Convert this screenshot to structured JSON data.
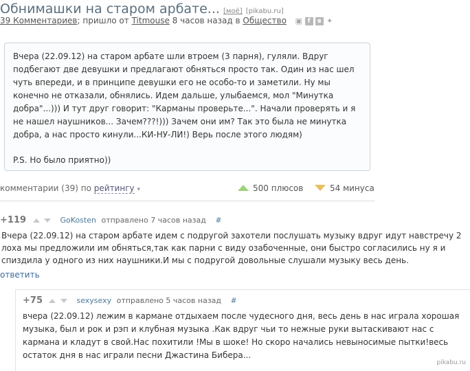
{
  "header": {
    "title": "Обнимашки на старом арбате...",
    "tag_mine": "[моё]",
    "source": "[pikabu.ru]"
  },
  "meta": {
    "comments_link": "39 Комментариев",
    "came_from": "; пришло от",
    "author": "Titmouse",
    "time": "8 часов назад в",
    "category": "Общество"
  },
  "share_icons": [
    "save-icon",
    "facebook-icon",
    "vkontakte-icon",
    "twitter-icon"
  ],
  "story": {
    "text": "Вчера (22.09.12) на старом арбате шли втроем (3 парня), гуляли. Вдруг подбегают две девушки и предлагают обняться просто так. Один из нас шел чуть впереди, и в принципе девушки его не особо-то и заметили. Ну мы конечно не отказали, обнялись. Идем дальше, улыбаемся, мол \"Минутка добра\"...))) И тут друг говорит: \"Карманы проверьте...\". Начали проверять и я не нашел наушников... Зачем???!))) Зачем они им? Так это была не минутка добра, а нас просто кинули...КИ-НУ-ЛИ!) Верь после этого людям)",
    "ps": "P.S. Но было приятно))"
  },
  "stats": {
    "comments_label": "комментарии (39) по",
    "sort_label": "рейтингу",
    "plus_label": "500 плюсов",
    "minus_label": "54 минуса",
    "plus_color": "#9fd37a",
    "minus_color": "#e8c060"
  },
  "comments": [
    {
      "score": "+119",
      "author": "GoKosten",
      "sent": "отправлено 7 часов назад",
      "hash": "#",
      "text": "Вчера (22.09.12) на старом арбате идем с подругой захотели послушать музыку вдруг идут навстречу 2 лоха мы предложили им обняться,так как парни с виду озабоченные, они быстро согласились ну я и спиздила у одного из них наушники.И мы с подругой довольные слушали музыку весь день.",
      "reply": "ответить"
    },
    {
      "score": "+75",
      "author": "sexysexy",
      "sent": "отправлено 5 часов назад",
      "hash": "#",
      "text": "вчера (22.09.12) лежим в кармане отдыхаем после чудесного дня, весь день в нас играла хорошая музыка, был и рок и рэп и клубная музыка .Как вдруг чьи то нежные руки вытаскивают нас с кармана и кладут в свой.Нас похитили !Мы в шоке! Но скоро начались невыносимые пытки!весь остаток дня в нас играли песни Джастина Бибера..."
    }
  ],
  "watermark": "pikabu.ru"
}
